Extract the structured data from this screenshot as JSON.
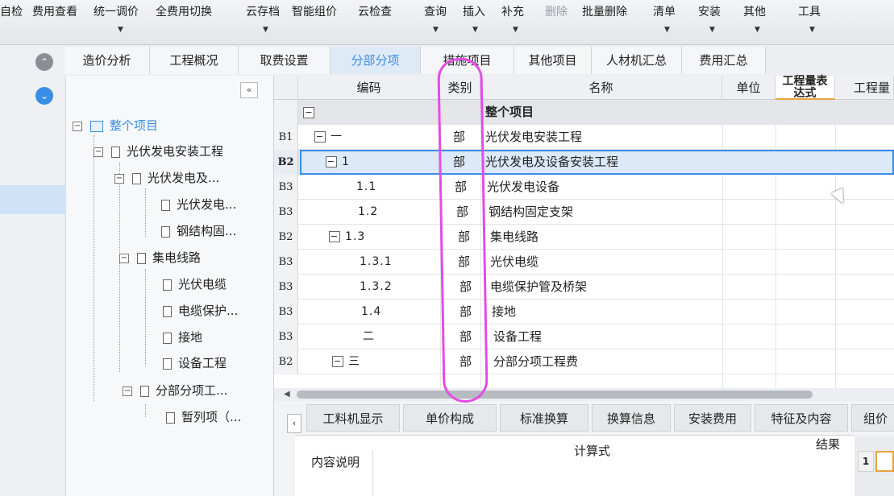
{
  "toolbar": {
    "items": [
      "自检",
      "费用查看",
      "统一调价",
      "全费用切换",
      "云存档",
      "智能组价",
      "云检查",
      "查询",
      "插入",
      "补充",
      "删除",
      "批量删除",
      "清单",
      "安装",
      "其他",
      "工具"
    ]
  },
  "tabs": [
    "造价分析",
    "工程概况",
    "取费设置",
    "分部分项",
    "措施项目",
    "其他项目",
    "人材机汇总",
    "费用汇总"
  ],
  "active_tab": "分部分项",
  "tree": {
    "collapse_label": "«",
    "nodes": [
      {
        "label": "整个项目",
        "level": 0
      },
      {
        "label": "光伏发电安装工程",
        "level": 1
      },
      {
        "label": "光伏发电及...",
        "level": 2
      },
      {
        "label": "光伏发电...",
        "level": 3
      },
      {
        "label": "钢结构固...",
        "level": 3
      },
      {
        "label": "集电线路",
        "level": 2
      },
      {
        "label": "光伏电缆",
        "level": 3
      },
      {
        "label": "电缆保护...",
        "level": 3
      },
      {
        "label": "接地",
        "level": 3
      },
      {
        "label": "设备工程",
        "level": 3
      },
      {
        "label": "分部分项工...",
        "level": 1
      },
      {
        "label": "暂列项（...",
        "level": 2
      }
    ]
  },
  "grid": {
    "headers": {
      "code": "编码",
      "type": "类别",
      "name": "名称",
      "unit": "单位",
      "qty_expr_line1": "工程量表",
      "qty_expr_line2": "达式",
      "qty": "工程量"
    },
    "rows": [
      {
        "rn": "",
        "code": "",
        "type": "",
        "name": "整个项目"
      },
      {
        "rn": "B1",
        "code": "一",
        "type": "部",
        "name": "光伏发电安装工程"
      },
      {
        "rn": "B2",
        "code": "1",
        "type": "部",
        "name": "光伏发电及设备安装工程"
      },
      {
        "rn": "B3",
        "code": "1.1",
        "type": "部",
        "name": "光伏发电设备"
      },
      {
        "rn": "B3",
        "code": "1.2",
        "type": "部",
        "name": "钢结构固定支架"
      },
      {
        "rn": "B2",
        "code": "1.3",
        "type": "部",
        "name": "集电线路"
      },
      {
        "rn": "B3",
        "code": "1.3.1",
        "type": "部",
        "name": "光伏电缆"
      },
      {
        "rn": "B3",
        "code": "1.3.2",
        "type": "部",
        "name": "电缆保护管及桥架"
      },
      {
        "rn": "B3",
        "code": "1.4",
        "type": "部",
        "name": "接地"
      },
      {
        "rn": "B3",
        "code": "二",
        "type": "部",
        "name": "设备工程"
      },
      {
        "rn": "B2",
        "code": "三",
        "type": "部",
        "name": "分部分项工程费"
      }
    ]
  },
  "bottom_tabs": [
    "工料机显示",
    "单价构成",
    "标准换算",
    "换算信息",
    "安装费用",
    "特征及内容",
    "组价"
  ],
  "formula": {
    "col_expr": "计算式",
    "col_result": "结果",
    "col_desc": "内容说明",
    "row_number": "1"
  },
  "colors": {
    "accent": "#3a8ee6",
    "annotation": "#e34de6"
  }
}
